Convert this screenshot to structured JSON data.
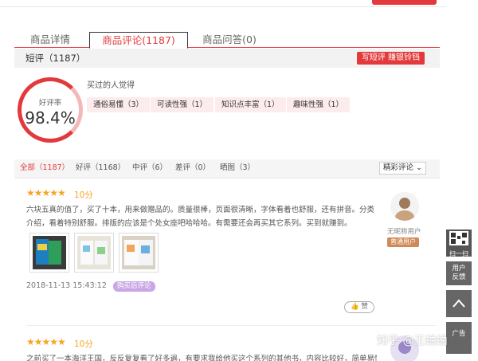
{
  "tabs": [
    {
      "label": "商品详情"
    },
    {
      "label": "商品评论(1187)"
    },
    {
      "label": "商品问答(0)"
    }
  ],
  "section": {
    "title": "短评（1187）",
    "write_button": "写短评 赚银铃铛"
  },
  "rating": {
    "label": "好评率",
    "value": "98.4%",
    "fraction": 0.984
  },
  "impressions": {
    "label": "买过的人觉得",
    "tags": [
      "通俗易懂（3）",
      "可读性强（1）",
      "知识点丰富（1）",
      "趣味性强（1）"
    ]
  },
  "filters": [
    "全部（1187）",
    "好评（1168）",
    "中评（6）",
    "差评（0）",
    "晒图（3）"
  ],
  "sort_label": "精彩评论",
  "reviews": [
    {
      "score": "10分",
      "text": "六块五真的值了，买了十本，用来做赠品的。质量很棒，页面很清晰，字体看着也舒服，还有拼音。分类介绍，看着特别舒服。排版的应该是个处女座吧哈哈哈。有需要还会再买其它系列。买到就赚到。",
      "date": "2018-11-13 15:43:12",
      "badge": "购买后评论",
      "like": "赞",
      "user_name": "无昵称用户",
      "user_level": "普通用户"
    },
    {
      "score": "10分",
      "text": "之前买了一本海洋王国，反反复复看了好多遍，有要求我给他买这个系列的其他书，内容比较好，简单易懂，配图"
    }
  ],
  "side": {
    "scan": "扫一扫",
    "feedback": "用户反馈",
    "ad": "广告"
  },
  "watermark": "知乎 @王蛐蛐",
  "colors": {
    "accent": "#e4393c",
    "star": "#f6a623",
    "tag_bg": "#fdeced",
    "badge_purple": "#c9a6e6",
    "level_bg": "#d18a56"
  }
}
